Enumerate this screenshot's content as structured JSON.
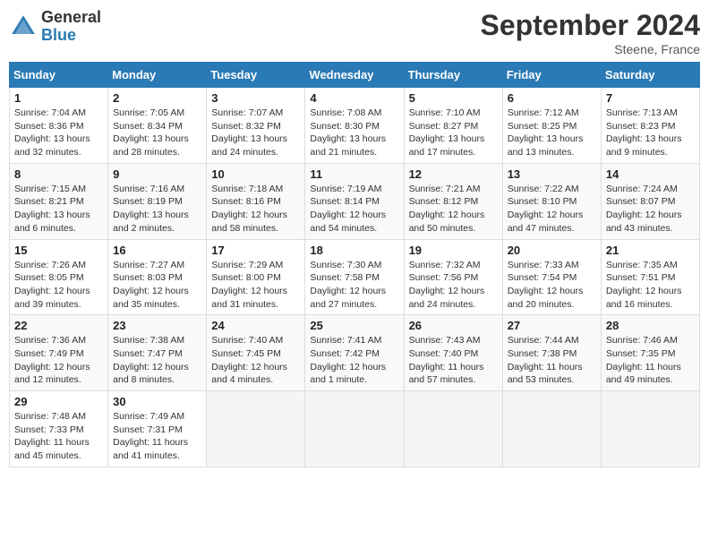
{
  "header": {
    "logo_general": "General",
    "logo_blue": "Blue",
    "title": "September 2024",
    "subtitle": "Steene, France"
  },
  "weekdays": [
    "Sunday",
    "Monday",
    "Tuesday",
    "Wednesday",
    "Thursday",
    "Friday",
    "Saturday"
  ],
  "weeks": [
    [
      {
        "day": "1",
        "info": "Sunrise: 7:04 AM\nSunset: 8:36 PM\nDaylight: 13 hours\nand 32 minutes."
      },
      {
        "day": "2",
        "info": "Sunrise: 7:05 AM\nSunset: 8:34 PM\nDaylight: 13 hours\nand 28 minutes."
      },
      {
        "day": "3",
        "info": "Sunrise: 7:07 AM\nSunset: 8:32 PM\nDaylight: 13 hours\nand 24 minutes."
      },
      {
        "day": "4",
        "info": "Sunrise: 7:08 AM\nSunset: 8:30 PM\nDaylight: 13 hours\nand 21 minutes."
      },
      {
        "day": "5",
        "info": "Sunrise: 7:10 AM\nSunset: 8:27 PM\nDaylight: 13 hours\nand 17 minutes."
      },
      {
        "day": "6",
        "info": "Sunrise: 7:12 AM\nSunset: 8:25 PM\nDaylight: 13 hours\nand 13 minutes."
      },
      {
        "day": "7",
        "info": "Sunrise: 7:13 AM\nSunset: 8:23 PM\nDaylight: 13 hours\nand 9 minutes."
      }
    ],
    [
      {
        "day": "8",
        "info": "Sunrise: 7:15 AM\nSunset: 8:21 PM\nDaylight: 13 hours\nand 6 minutes."
      },
      {
        "day": "9",
        "info": "Sunrise: 7:16 AM\nSunset: 8:19 PM\nDaylight: 13 hours\nand 2 minutes."
      },
      {
        "day": "10",
        "info": "Sunrise: 7:18 AM\nSunset: 8:16 PM\nDaylight: 12 hours\nand 58 minutes."
      },
      {
        "day": "11",
        "info": "Sunrise: 7:19 AM\nSunset: 8:14 PM\nDaylight: 12 hours\nand 54 minutes."
      },
      {
        "day": "12",
        "info": "Sunrise: 7:21 AM\nSunset: 8:12 PM\nDaylight: 12 hours\nand 50 minutes."
      },
      {
        "day": "13",
        "info": "Sunrise: 7:22 AM\nSunset: 8:10 PM\nDaylight: 12 hours\nand 47 minutes."
      },
      {
        "day": "14",
        "info": "Sunrise: 7:24 AM\nSunset: 8:07 PM\nDaylight: 12 hours\nand 43 minutes."
      }
    ],
    [
      {
        "day": "15",
        "info": "Sunrise: 7:26 AM\nSunset: 8:05 PM\nDaylight: 12 hours\nand 39 minutes."
      },
      {
        "day": "16",
        "info": "Sunrise: 7:27 AM\nSunset: 8:03 PM\nDaylight: 12 hours\nand 35 minutes."
      },
      {
        "day": "17",
        "info": "Sunrise: 7:29 AM\nSunset: 8:00 PM\nDaylight: 12 hours\nand 31 minutes."
      },
      {
        "day": "18",
        "info": "Sunrise: 7:30 AM\nSunset: 7:58 PM\nDaylight: 12 hours\nand 27 minutes."
      },
      {
        "day": "19",
        "info": "Sunrise: 7:32 AM\nSunset: 7:56 PM\nDaylight: 12 hours\nand 24 minutes."
      },
      {
        "day": "20",
        "info": "Sunrise: 7:33 AM\nSunset: 7:54 PM\nDaylight: 12 hours\nand 20 minutes."
      },
      {
        "day": "21",
        "info": "Sunrise: 7:35 AM\nSunset: 7:51 PM\nDaylight: 12 hours\nand 16 minutes."
      }
    ],
    [
      {
        "day": "22",
        "info": "Sunrise: 7:36 AM\nSunset: 7:49 PM\nDaylight: 12 hours\nand 12 minutes."
      },
      {
        "day": "23",
        "info": "Sunrise: 7:38 AM\nSunset: 7:47 PM\nDaylight: 12 hours\nand 8 minutes."
      },
      {
        "day": "24",
        "info": "Sunrise: 7:40 AM\nSunset: 7:45 PM\nDaylight: 12 hours\nand 4 minutes."
      },
      {
        "day": "25",
        "info": "Sunrise: 7:41 AM\nSunset: 7:42 PM\nDaylight: 12 hours\nand 1 minute."
      },
      {
        "day": "26",
        "info": "Sunrise: 7:43 AM\nSunset: 7:40 PM\nDaylight: 11 hours\nand 57 minutes."
      },
      {
        "day": "27",
        "info": "Sunrise: 7:44 AM\nSunset: 7:38 PM\nDaylight: 11 hours\nand 53 minutes."
      },
      {
        "day": "28",
        "info": "Sunrise: 7:46 AM\nSunset: 7:35 PM\nDaylight: 11 hours\nand 49 minutes."
      }
    ],
    [
      {
        "day": "29",
        "info": "Sunrise: 7:48 AM\nSunset: 7:33 PM\nDaylight: 11 hours\nand 45 minutes."
      },
      {
        "day": "30",
        "info": "Sunrise: 7:49 AM\nSunset: 7:31 PM\nDaylight: 11 hours\nand 41 minutes."
      },
      {
        "day": "",
        "info": ""
      },
      {
        "day": "",
        "info": ""
      },
      {
        "day": "",
        "info": ""
      },
      {
        "day": "",
        "info": ""
      },
      {
        "day": "",
        "info": ""
      }
    ]
  ]
}
